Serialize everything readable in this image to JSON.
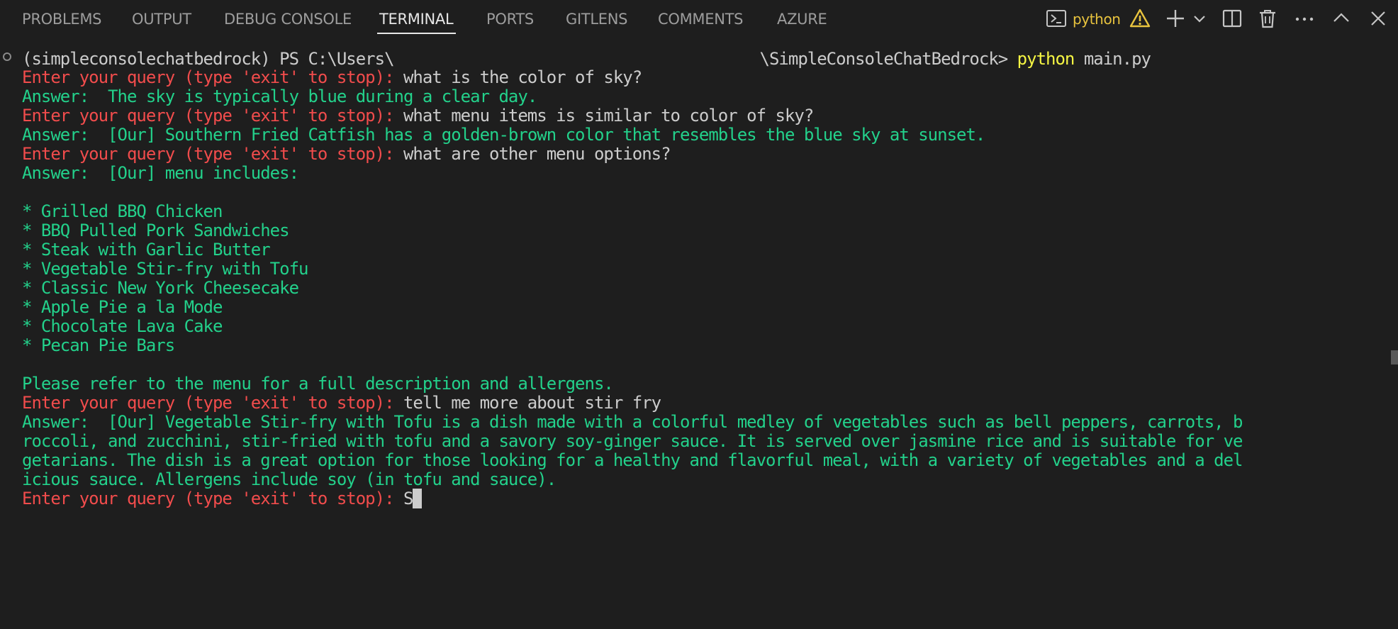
{
  "tabs": [
    {
      "label": "PROBLEMS"
    },
    {
      "label": "OUTPUT"
    },
    {
      "label": "DEBUG CONSOLE"
    },
    {
      "label": "TERMINAL",
      "active": true
    },
    {
      "label": "PORTS"
    },
    {
      "label": "GITLENS"
    },
    {
      "label": "COMMENTS"
    },
    {
      "label": "AZURE"
    }
  ],
  "toolbar": {
    "terminal_profile": "python",
    "icons": [
      "terminal-icon",
      "warning-icon",
      "add-icon",
      "chevron-down-icon",
      "split-icon",
      "trash-icon",
      "more-icon",
      "maximize-icon",
      "close-icon"
    ]
  },
  "colors": {
    "background": "#1e1e1e",
    "prompt_red": "#f14c4c",
    "answer_green": "#23d18b",
    "command_yellow": "#f5f543",
    "text_white": "#cccccc",
    "warning_yellow": "#e8c33e"
  },
  "terminal": {
    "prompt_line": {
      "env": "(simpleconsolechatbedrock) PS C:\\Users\\",
      "path_end": "\\SimpleConsoleChatBedrock>",
      "command": "python",
      "args": " main.py"
    },
    "query_prompt": "Enter your query (type 'exit' to stop): ",
    "answer_prefix": "Answer:  ",
    "q1": "what is the color of sky?",
    "a1": "The sky is typically blue during a clear day.",
    "q2": "what menu items is similar to color of sky?",
    "a2": "[Our] Southern Fried Catfish has a golden-brown color that resembles the blue sky at sunset.",
    "q3": "what are other menu options?",
    "a3": "[Our] menu includes:",
    "menu_items": [
      "* Grilled BBQ Chicken",
      "* BBQ Pulled Pork Sandwiches",
      "* Steak with Garlic Butter",
      "* Vegetable Stir-fry with Tofu",
      "* Classic New York Cheesecake",
      "* Apple Pie a la Mode",
      "* Chocolate Lava Cake",
      "* Pecan Pie Bars"
    ],
    "a3_footer": "Please refer to the menu for a full description and allergens.",
    "q4": "tell me more about stir fry",
    "a4_lines": [
      "[Our] Vegetable Stir-fry with Tofu is a dish made with a colorful medley of vegetables such as bell peppers, carrots, b",
      "roccoli, and zucchini, stir-fried with tofu and a savory soy-ginger sauce. It is served over jasmine rice and is suitable for ve",
      "getarians. The dish is a great option for those looking for a healthy and flavorful meal, with a variety of vegetables and a del",
      "icious sauce. Allergens include soy (in tofu and sauce)."
    ],
    "current_input": "S"
  }
}
